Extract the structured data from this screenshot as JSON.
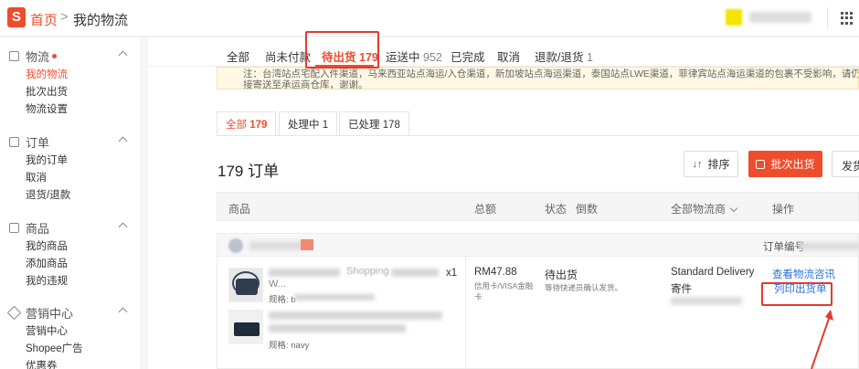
{
  "header": {
    "logo_letter": "S",
    "home": "首页",
    "breadcrumb_sep": ">",
    "current": "我的物流"
  },
  "sidebar": {
    "sections": [
      {
        "title": "物流",
        "items": [
          "我的物流",
          "批次出货",
          "物流设置"
        ]
      },
      {
        "title": "订单",
        "items": [
          "我的订单",
          "取消",
          "退货/退款"
        ]
      },
      {
        "title": "商品",
        "items": [
          "我的商品",
          "添加商品",
          "我的违规"
        ]
      },
      {
        "title": "营销中心",
        "items": [
          "营销中心",
          "Shopee广告",
          "优惠券"
        ]
      }
    ]
  },
  "tabs": [
    {
      "label": "全部",
      "count": ""
    },
    {
      "label": "尚未付款",
      "count": ""
    },
    {
      "label": "待出货",
      "count": "179"
    },
    {
      "label": "运送中",
      "count": "952"
    },
    {
      "label": "已完成",
      "count": ""
    },
    {
      "label": "取消",
      "count": ""
    },
    {
      "label": "退款/退货",
      "count": "1"
    }
  ],
  "notice": {
    "text": "注：台湾站点宅配入件渠道，马来西亚站点海运/入仓渠道，新加坡站点海运渠道，泰国站点LWE渠道，菲律宾站点海运渠道的包裹不受影响，请仍直接寄送至承运商仓库，谢谢。"
  },
  "subtabs": [
    {
      "label": "全部",
      "count": "179"
    },
    {
      "label": "处理中",
      "count": "1"
    },
    {
      "label": "已处理",
      "count": "178"
    }
  ],
  "orders_count": "179 订单",
  "toolbar": {
    "sort_icon": "↓↑",
    "sort_label": "排序",
    "batch_label": "批次出货",
    "ship_label": "发货"
  },
  "table_headers": {
    "product": "商品",
    "total": "总额",
    "status": "状态",
    "countdown": "倒数",
    "logistics": "全部物流商",
    "action": "操作"
  },
  "order": {
    "order_no_label": "订单编号",
    "order_no_tail": "T5",
    "items": [
      {
        "title_visible": "Shopping",
        "title_suffix": "W...",
        "spec": "规格: b",
        "qty": "x1"
      },
      {
        "spec": "规格: navy"
      }
    ],
    "amount": "RM47.88",
    "payment": "信用卡/VISA金融卡",
    "status": "待出货",
    "status_sub": "等待快递员确认发货。",
    "carrier": "Standard Delivery",
    "carrier_type": "寄件",
    "actions": {
      "view_logistics": "查看物流咨讯",
      "print_waybill": "列印出货单"
    }
  }
}
